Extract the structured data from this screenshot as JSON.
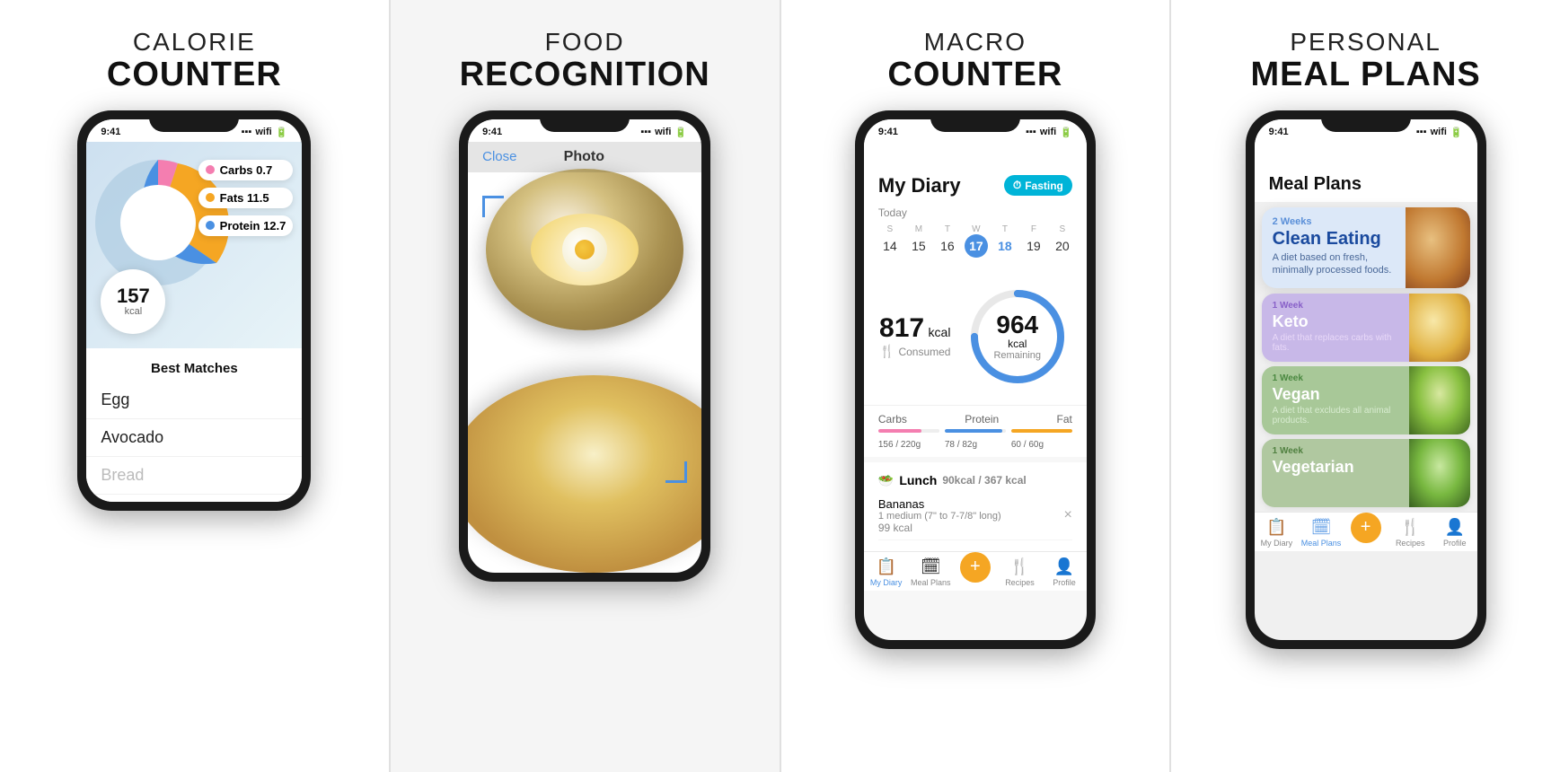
{
  "panels": [
    {
      "id": "calorie-counter",
      "title_light": "CALORIE",
      "title_bold": "COUNTER",
      "phone": {
        "time": "9:41",
        "chart": {
          "carbs_label": "Carbs 0.7",
          "fats_label": "Fats 11.5",
          "protein_label": "Protein 12.7",
          "carbs_color": "#f47eb0",
          "fats_color": "#f5a623",
          "protein_color": "#4a90e2",
          "bg_color": "#a8c8e8",
          "kcal_value": "157",
          "kcal_unit": "kcal"
        },
        "food_list": {
          "header": "Best Matches",
          "items": [
            "Egg",
            "Avocado",
            "Bread"
          ]
        }
      }
    },
    {
      "id": "food-recognition",
      "title_light": "FOOD",
      "title_bold": "RECOGNITION",
      "phone": {
        "time": "9:41",
        "close_label": "Close",
        "photo_label": "Photo"
      }
    },
    {
      "id": "macro-counter",
      "title_light": "MACRO",
      "title_bold": "COUNTER",
      "phone": {
        "time": "9:41",
        "diary_title": "My Diary",
        "fasting_label": "Fasting",
        "today_label": "Today",
        "calendar": {
          "days": [
            "S",
            "M",
            "T",
            "W",
            "T",
            "F",
            "S"
          ],
          "dates": [
            "14",
            "15",
            "16",
            "17",
            "18",
            "19",
            "20"
          ],
          "today_index": 3,
          "highlighted_index": 4
        },
        "consumed": {
          "value": "817",
          "unit": "kcal",
          "label": "Consumed"
        },
        "remaining": {
          "value": "964",
          "unit": "kcal",
          "label": "Remaining"
        },
        "macros": [
          {
            "name": "Carbs",
            "current": 156,
            "goal": 220,
            "color": "#f47eb0",
            "display": "156 / 220g"
          },
          {
            "name": "Protein",
            "current": 78,
            "goal": 82,
            "color": "#4a90e2",
            "display": "78 / 82g"
          },
          {
            "name": "Fat",
            "current": 60,
            "goal": 60,
            "color": "#f5a623",
            "display": "60 / 60g"
          }
        ],
        "lunch": {
          "emoji": "🥗",
          "label": "Lunch",
          "cal": "90kcal / 367 kcal",
          "items": [
            {
              "name": "Bananas",
              "desc": "1 medium (7\" to 7-7/8\" long)",
              "kcal": "99 kcal"
            }
          ]
        },
        "tabs": [
          {
            "label": "My Diary",
            "icon": "📋",
            "active": true
          },
          {
            "label": "Meal Plans",
            "icon": "🗓",
            "active": false
          },
          {
            "label": "+",
            "icon": "+",
            "active": false
          },
          {
            "label": "Recipes",
            "icon": "🍴",
            "active": false
          },
          {
            "label": "Profile",
            "icon": "👤",
            "active": false
          }
        ]
      }
    },
    {
      "id": "meal-plans",
      "title_light": "PERSONAL",
      "title_bold": "MEAL PLANS",
      "phone": {
        "time": "9:41",
        "header": "Meal Plans",
        "plans": [
          {
            "id": "clean-eating",
            "week": "2 Weeks",
            "name": "Clean Eating",
            "desc": "A diet based on fresh, minimally processed foods.",
            "style": "clean"
          },
          {
            "id": "keto",
            "week": "1 Week",
            "name": "Keto",
            "desc": "A diet that replaces carbs with fats.",
            "style": "keto"
          },
          {
            "id": "vegan",
            "week": "1 Week",
            "name": "Vegan",
            "desc": "A diet that excludes all animal products.",
            "style": "vegan"
          },
          {
            "id": "vegetarian",
            "week": "1 Week",
            "name": "Vegetarian",
            "desc": "",
            "style": "vegetarian"
          }
        ],
        "tabs": [
          {
            "label": "My Diary",
            "icon": "📋",
            "active": false
          },
          {
            "label": "Meal Plans",
            "icon": "🗓",
            "active": true
          },
          {
            "label": "+",
            "icon": "+",
            "active": false
          },
          {
            "label": "Recipes",
            "icon": "🍴",
            "active": false
          },
          {
            "label": "Profile",
            "icon": "👤",
            "active": false
          }
        ]
      }
    }
  ]
}
